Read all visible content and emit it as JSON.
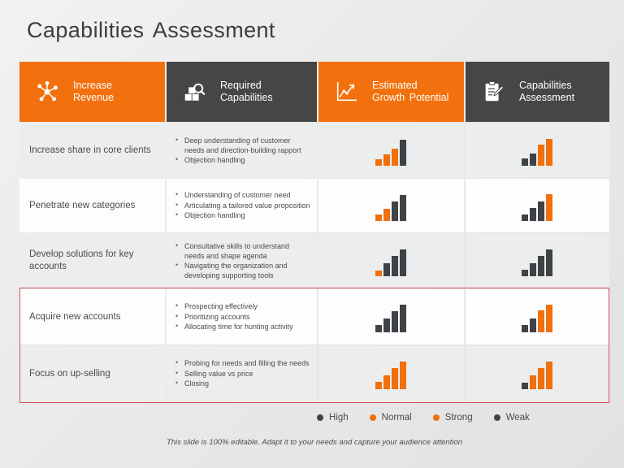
{
  "slide": {
    "title": "Capabilities  Assessment",
    "footnote": "This slide is 100% editable. Adapt it to your needs and capture your audience attention"
  },
  "colors": {
    "orange": "#f2700d",
    "dark": "#464646",
    "bar_orange": "#f0700e",
    "bar_dark": "#3f4246",
    "highlight_border": "#d4525c",
    "row_grey": "#eceded",
    "row_white": "#fdfdfd"
  },
  "header": {
    "columns": [
      {
        "label": "Increase\nRevenue",
        "icon": "network-nodes-icon",
        "style": "orange"
      },
      {
        "label": "Required\nCapabilities",
        "icon": "boxes-search-icon",
        "style": "dark"
      },
      {
        "label": "Estimated\nGrowth Potential",
        "icon": "growth-chart-icon",
        "style": "orange"
      },
      {
        "label": "Capabilities\nAssessment",
        "icon": "clipboard-pencil-icon",
        "style": "dark"
      }
    ]
  },
  "rows": [
    {
      "label": "Increase share in core clients",
      "bullets": [
        "Deep understanding of customer needs and direction-building rapport",
        "Objection handling"
      ],
      "growth_potential": {
        "type": "bar",
        "values": [
          8,
          14,
          21,
          32
        ],
        "colors": [
          "orange",
          "orange",
          "orange",
          "dark"
        ]
      },
      "assessment": {
        "type": "bar",
        "values": [
          9,
          15,
          26,
          33
        ],
        "colors": [
          "dark",
          "dark",
          "orange",
          "orange"
        ]
      }
    },
    {
      "label": "Penetrate new categories",
      "bullets": [
        "Understanding of customer need",
        "Articulating a tailored value proposition",
        "Objection handling"
      ],
      "growth_potential": {
        "type": "bar",
        "values": [
          8,
          15,
          24,
          32
        ],
        "colors": [
          "orange",
          "orange",
          "dark",
          "dark"
        ]
      },
      "assessment": {
        "type": "bar",
        "values": [
          8,
          16,
          24,
          33
        ],
        "colors": [
          "dark",
          "dark",
          "dark",
          "orange"
        ]
      }
    },
    {
      "label": "Develop solutions for key accounts",
      "bullets": [
        "Consultative skills to understand needs and shape agenda",
        "Navigating the organization and developing supporting tools"
      ],
      "growth_potential": {
        "type": "bar",
        "values": [
          7,
          16,
          25,
          33
        ],
        "colors": [
          "orange",
          "dark",
          "dark",
          "dark"
        ]
      },
      "assessment": {
        "type": "bar",
        "values": [
          8,
          16,
          25,
          33
        ],
        "colors": [
          "dark",
          "dark",
          "dark",
          "dark"
        ]
      }
    },
    {
      "label": "Acquire new accounts",
      "bullets": [
        "Prospecting effectively",
        "Prioritizing accounts",
        "Allocating time for hunting activity"
      ],
      "growth_potential": {
        "type": "bar",
        "values": [
          9,
          17,
          26,
          34
        ],
        "colors": [
          "dark",
          "dark",
          "dark",
          "dark"
        ]
      },
      "assessment": {
        "type": "bar",
        "values": [
          9,
          17,
          27,
          34
        ],
        "colors": [
          "dark",
          "dark",
          "orange",
          "orange"
        ]
      }
    },
    {
      "label": "Focus on up-selling",
      "bullets": [
        "Probing for needs and filling the needs",
        "Selling value vs price",
        "Closing"
      ],
      "growth_potential": {
        "type": "bar",
        "values": [
          9,
          17,
          26,
          34
        ],
        "colors": [
          "orange",
          "orange",
          "orange",
          "orange"
        ]
      },
      "assessment": {
        "type": "bar",
        "values": [
          8,
          17,
          26,
          34
        ],
        "colors": [
          "dark",
          "orange",
          "orange",
          "orange"
        ]
      }
    }
  ],
  "legend": [
    {
      "label": "High",
      "color": "#3f4246"
    },
    {
      "label": "Normal",
      "color": "#f0700e"
    },
    {
      "label": "Strong",
      "color": "#f0700e"
    },
    {
      "label": "Weak",
      "color": "#3f4246"
    }
  ],
  "chart_data": {
    "type": "bar",
    "title": "Capabilities Assessment",
    "categories": [
      "Increase share in core clients",
      "Penetrate new categories",
      "Develop solutions for key accounts",
      "Acquire new accounts",
      "Focus on up-selling"
    ],
    "series": [
      {
        "name": "Estimated Growth Potential",
        "values": [
          [
            8,
            14,
            21,
            32
          ],
          [
            8,
            15,
            24,
            32
          ],
          [
            7,
            16,
            25,
            33
          ],
          [
            9,
            17,
            26,
            34
          ],
          [
            9,
            17,
            26,
            34
          ]
        ],
        "colors": [
          [
            "orange",
            "orange",
            "orange",
            "dark"
          ],
          [
            "orange",
            "orange",
            "dark",
            "dark"
          ],
          [
            "orange",
            "dark",
            "dark",
            "dark"
          ],
          [
            "dark",
            "dark",
            "dark",
            "dark"
          ],
          [
            "orange",
            "orange",
            "orange",
            "orange"
          ]
        ]
      },
      {
        "name": "Capabilities Assessment",
        "values": [
          [
            9,
            15,
            26,
            33
          ],
          [
            8,
            16,
            24,
            33
          ],
          [
            8,
            16,
            25,
            33
          ],
          [
            9,
            17,
            27,
            34
          ],
          [
            8,
            17,
            26,
            34
          ]
        ],
        "colors": [
          [
            "dark",
            "dark",
            "orange",
            "orange"
          ],
          [
            "dark",
            "dark",
            "dark",
            "orange"
          ],
          [
            "dark",
            "dark",
            "dark",
            "dark"
          ],
          [
            "dark",
            "dark",
            "orange",
            "orange"
          ],
          [
            "dark",
            "orange",
            "orange",
            "orange"
          ]
        ]
      }
    ],
    "legend_entries": [
      "High",
      "Normal",
      "Strong",
      "Weak"
    ],
    "legend_position": "bottom",
    "grid": false,
    "xlabel": "",
    "ylabel": ""
  }
}
